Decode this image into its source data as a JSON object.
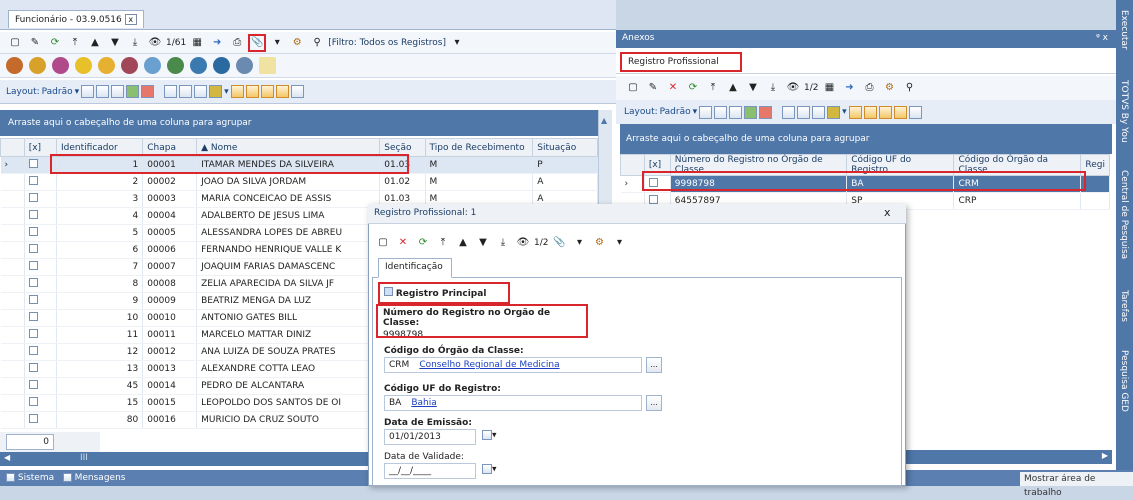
{
  "left": {
    "doc_tab": "Funcionário - 03.9.0516",
    "nav_counter": "1/61",
    "filter_label": "[Filtro: Todos os Registros]",
    "layout_label": "Layout:",
    "layout_value": "Padrão",
    "group_hint": "Arraste aqui o cabeçalho de uma coluna para agrupar",
    "columns": [
      "[x]",
      "Identificador",
      "Chapa",
      "Nome",
      "Seção",
      "Tipo de Recebimento",
      "Situação"
    ],
    "rows": [
      {
        "id": "1",
        "chapa": "00001",
        "nome": "ITAMAR MENDES DA SILVEIRA",
        "secao": "01.03",
        "tipo": "M",
        "sit": "P"
      },
      {
        "id": "2",
        "chapa": "00002",
        "nome": "JOAO DA SILVA JORDAM",
        "secao": "01.02",
        "tipo": "M",
        "sit": "A"
      },
      {
        "id": "3",
        "chapa": "00003",
        "nome": "MARIA CONCEICAO DE ASSIS",
        "secao": "01.03",
        "tipo": "M",
        "sit": "A"
      },
      {
        "id": "4",
        "chapa": "00004",
        "nome": "ADALBERTO DE JESUS LIMA",
        "secao": "",
        "tipo": "",
        "sit": ""
      },
      {
        "id": "5",
        "chapa": "00005",
        "nome": "ALESSANDRA LOPES DE ABREU",
        "secao": "",
        "tipo": "",
        "sit": ""
      },
      {
        "id": "6",
        "chapa": "00006",
        "nome": "FERNANDO HENRIQUE VALLE K",
        "secao": "",
        "tipo": "",
        "sit": ""
      },
      {
        "id": "7",
        "chapa": "00007",
        "nome": "JOAQUIM FARIAS DAMASCENC",
        "secao": "",
        "tipo": "",
        "sit": ""
      },
      {
        "id": "8",
        "chapa": "00008",
        "nome": "ZELIA APARECIDA DA SILVA JF",
        "secao": "",
        "tipo": "",
        "sit": ""
      },
      {
        "id": "9",
        "chapa": "00009",
        "nome": "BEATRIZ MENGA DA LUZ",
        "secao": "",
        "tipo": "",
        "sit": ""
      },
      {
        "id": "10",
        "chapa": "00010",
        "nome": "ANTONIO GATES BILL",
        "secao": "",
        "tipo": "",
        "sit": ""
      },
      {
        "id": "11",
        "chapa": "00011",
        "nome": "MARCELO MATTAR DINIZ",
        "secao": "",
        "tipo": "",
        "sit": ""
      },
      {
        "id": "12",
        "chapa": "00012",
        "nome": "ANA LUIZA  DE SOUZA PRATES",
        "secao": "",
        "tipo": "",
        "sit": ""
      },
      {
        "id": "13",
        "chapa": "00013",
        "nome": "ALEXANDRE COTTA LEAO",
        "secao": "",
        "tipo": "",
        "sit": ""
      },
      {
        "id": "45",
        "chapa": "00014",
        "nome": "PEDRO DE ALCANTARA",
        "secao": "",
        "tipo": "",
        "sit": ""
      },
      {
        "id": "15",
        "chapa": "00015",
        "nome": "LEOPOLDO DOS SANTOS DE OI",
        "secao": "",
        "tipo": "",
        "sit": ""
      },
      {
        "id": "80",
        "chapa": "00016",
        "nome": "MURICIO DA CRUZ SOUTO",
        "secao": "",
        "tipo": "",
        "sit": ""
      }
    ],
    "count_value": "0"
  },
  "right": {
    "title": "Anexos",
    "title_controls": "ᵠ x",
    "tab": "Registro Profissional",
    "nav_counter": "1/2",
    "layout_label": "Layout:",
    "layout_value": "Padrão",
    "group_hint": "Arraste aqui o cabeçalho de uma coluna para agrupar",
    "columns": [
      "[x]",
      "Número do Registro no Órgão de Classe",
      "Código UF do Registro",
      "Código do Órgão da Classe",
      "Regi"
    ],
    "rows": [
      {
        "num": "9998798",
        "uf": "BA",
        "orgao": "CRM"
      },
      {
        "num": "64557897",
        "uf": "SP",
        "orgao": "CRP"
      }
    ]
  },
  "dialog": {
    "title": "Registro Profissional: 1",
    "close": "x",
    "nav_counter": "1/2",
    "tab": "Identificação",
    "principal_label": "Registro Principal",
    "num_label": "Número do Registro no Orgão de Classe:",
    "num_value": "9998798",
    "orgao_label": "Código do Órgão da Classe:",
    "orgao_code": "CRM",
    "orgao_name": "Conselho Regional de Medicina",
    "uf_label": "Código UF do Registro:",
    "uf_code": "BA",
    "uf_name": "Bahia",
    "emissao_label": "Data de Emissão:",
    "emissao_value": "01/01/2013",
    "validade_label": "Data de Validade:",
    "validade_value": "__/__/____",
    "lookup": "...",
    "dropdown": "▾"
  },
  "status": {
    "sistema": "Sistema",
    "mensagens": "Mensagens",
    "show_area": "Mostrar área de trabalho"
  },
  "sidebar": [
    "Executar",
    "TOTVS By You",
    "Central de Pesquisa",
    "Tarefas",
    "Pesquisa GED"
  ]
}
